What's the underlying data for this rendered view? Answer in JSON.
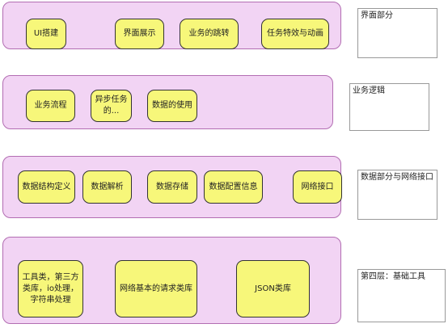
{
  "layers": {
    "ui": {
      "nodes": [
        "UI搭建",
        "界面展示",
        "业务的跳转",
        "任务特效与动画"
      ],
      "note": "界面部分"
    },
    "business": {
      "nodes": [
        "业务流程",
        "异步任务的...",
        "数据的使用"
      ],
      "note": "业务逻辑"
    },
    "data": {
      "nodes": [
        "数据结构定义",
        "数据解析",
        "数据存储",
        "数据配置信息",
        "网络接口"
      ],
      "note": "数据部分与网络接口"
    },
    "tools": {
      "nodes": [
        "工具类，第三方类库，io处理，字符串处理",
        "网络基本的请求类库",
        "JSON类库"
      ],
      "note": "第四层：基础工具"
    }
  },
  "colors": {
    "layer_fill": "#f2d4f4",
    "layer_border": "#b26db2",
    "node_fill": "#f7f77a",
    "node_border": "#333333"
  }
}
